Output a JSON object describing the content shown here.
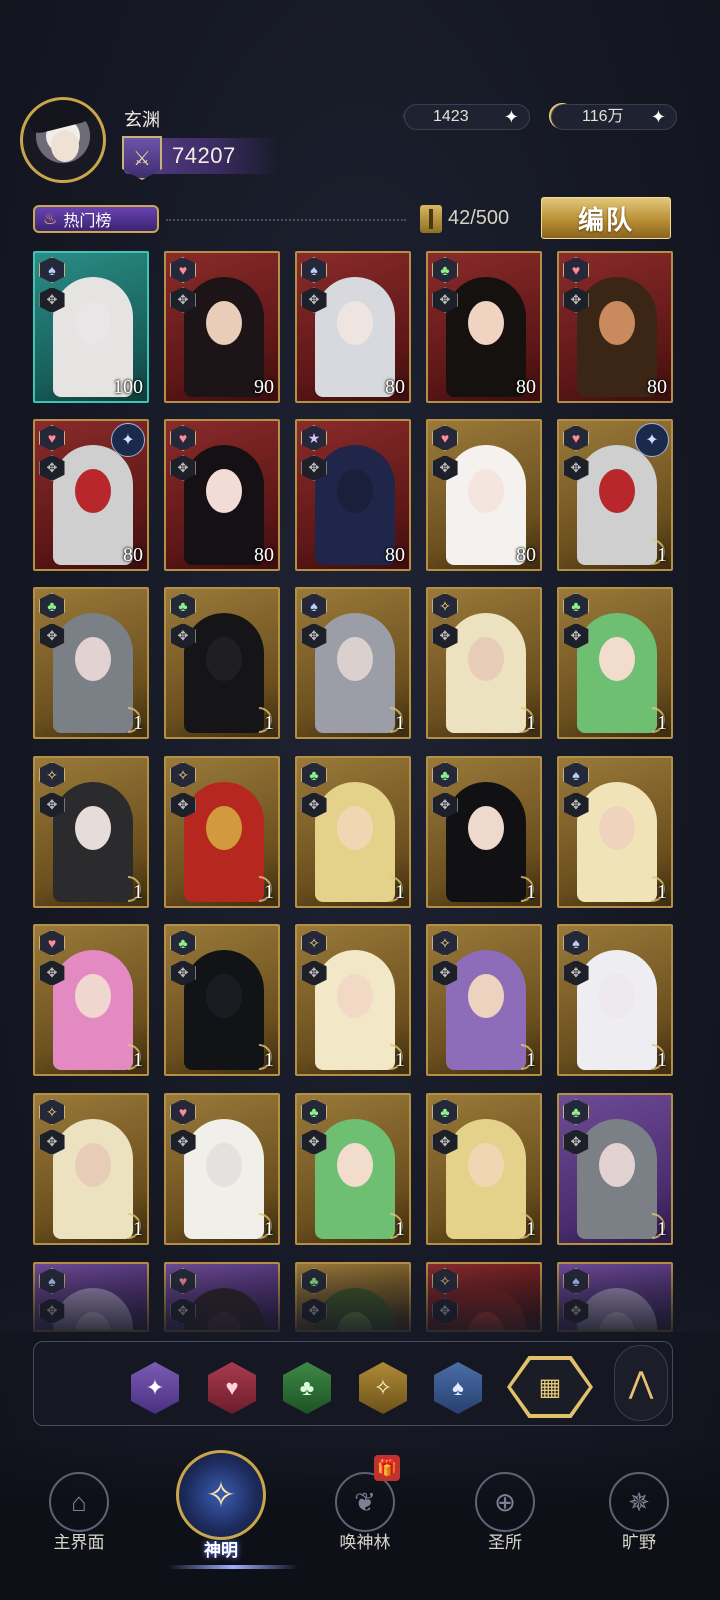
{
  "header": {
    "username": "玄渊",
    "power": "74207",
    "currencies": [
      {
        "name": "star-gem",
        "value": "1423"
      },
      {
        "name": "gold-coin",
        "value": "116万"
      }
    ]
  },
  "toolbar": {
    "hot_tab_label": "热门榜",
    "card_count": "42/500",
    "team_button": "编队"
  },
  "cards": [
    {
      "frame": "teal",
      "element": "spade",
      "level": "100",
      "face": "#e8e6e6",
      "hair": "#e6e4e2"
    },
    {
      "frame": "red",
      "element": "heart",
      "level": "90",
      "face": "#e9cdb9",
      "hair": "#1c1416"
    },
    {
      "frame": "red",
      "element": "spade",
      "level": "80",
      "face": "#eee5e1",
      "hair": "#d7d9de"
    },
    {
      "frame": "red",
      "element": "club",
      "level": "80",
      "face": "#f0d3c0",
      "hair": "#15110f"
    },
    {
      "frame": "red",
      "element": "heart",
      "level": "80",
      "face": "#c98b5d",
      "hair": "#3b2616"
    },
    {
      "frame": "red",
      "element": "heart",
      "level": "80",
      "face": "#b8272b",
      "hair": "#cfcfcf",
      "badge": "✦"
    },
    {
      "frame": "red",
      "element": "heart",
      "level": "80",
      "face": "#f3dcd6",
      "hair": "#141013"
    },
    {
      "frame": "red",
      "element": "star",
      "level": "80",
      "face": "#1a1f3a",
      "hair": "#20264a"
    },
    {
      "frame": "gold",
      "element": "heart",
      "level": "80",
      "face": "#f4e6df",
      "hair": "#f5f1ee"
    },
    {
      "frame": "gold",
      "element": "heart",
      "level": "1",
      "face": "#b8272b",
      "hair": "#cfcfcf",
      "badge": "✦"
    },
    {
      "frame": "gold",
      "element": "club",
      "level": "1",
      "face": "#e2d3d2",
      "hair": "#7b8087"
    },
    {
      "frame": "gold",
      "element": "club",
      "level": "1",
      "face": "#1f1f22",
      "hair": "#151518"
    },
    {
      "frame": "gold",
      "element": "spade",
      "level": "1",
      "face": "#dad0ce",
      "hair": "#9b9ea6"
    },
    {
      "frame": "gold",
      "element": "gold",
      "level": "1",
      "face": "#e7cdb8",
      "hair": "#ede2c0"
    },
    {
      "frame": "gold",
      "element": "club",
      "level": "1",
      "face": "#f2dccc",
      "hair": "#6fbf73"
    },
    {
      "frame": "gold",
      "element": "gold",
      "level": "1",
      "face": "#e6dcd9",
      "hair": "#2b2a2c"
    },
    {
      "frame": "gold",
      "element": "gold",
      "level": "1",
      "face": "#d39a3d",
      "hair": "#b5271f"
    },
    {
      "frame": "gold",
      "element": "club",
      "level": "1",
      "face": "#f1d6b4",
      "hair": "#e5d28a"
    },
    {
      "frame": "gold",
      "element": "club",
      "level": "1",
      "face": "#efd8cc",
      "hair": "#111013"
    },
    {
      "frame": "gold",
      "element": "spade",
      "level": "1",
      "face": "#f0d3bd",
      "hair": "#f1e3b8"
    },
    {
      "frame": "gold",
      "element": "heart",
      "level": "1",
      "face": "#efd6cf",
      "hair": "#e48ac2"
    },
    {
      "frame": "gold",
      "element": "club",
      "level": "1",
      "face": "#1a1c22",
      "hair": "#121317"
    },
    {
      "frame": "gold",
      "element": "gold",
      "level": "1",
      "face": "#f1d9c6",
      "hair": "#f2e8c8"
    },
    {
      "frame": "gold",
      "element": "gold",
      "level": "1",
      "face": "#edd2bf",
      "hair": "#8d6db9"
    },
    {
      "frame": "gold",
      "element": "spade",
      "level": "1",
      "face": "#ece8eb",
      "hair": "#eeeef2"
    },
    {
      "frame": "gold",
      "element": "gold",
      "level": "1",
      "face": "#e7cdb8",
      "hair": "#ede2c0"
    },
    {
      "frame": "gold",
      "element": "heart",
      "level": "1",
      "face": "#e4e2de",
      "hair": "#f1efea"
    },
    {
      "frame": "gold",
      "element": "club",
      "level": "1",
      "face": "#f2dccc",
      "hair": "#6fbf73"
    },
    {
      "frame": "gold",
      "element": "club",
      "level": "1",
      "face": "#f1d6b4",
      "hair": "#e5d28a"
    },
    {
      "frame": "purple",
      "element": "club",
      "level": "1",
      "face": "#e2d3d2",
      "hair": "#7b8087"
    },
    {
      "frame": "purple",
      "element": "spade",
      "level": "",
      "face": "#c9b7d8",
      "hair": "#9c8ab4"
    },
    {
      "frame": "purple",
      "element": "heart",
      "level": "",
      "face": "#4a2f3a",
      "hair": "#2d2026"
    },
    {
      "frame": "gold",
      "element": "club",
      "level": "",
      "face": "#6a8c3a",
      "hair": "#3d5422"
    },
    {
      "frame": "red",
      "element": "gold",
      "level": "",
      "face": "#b5342c",
      "hair": "#7a1d1a"
    },
    {
      "frame": "purple",
      "element": "spade",
      "level": "",
      "face": "#c9b7d8",
      "hair": "#9c8ab4"
    }
  ],
  "filters": [
    {
      "name": "star",
      "glyph": "✦"
    },
    {
      "name": "heart",
      "glyph": "♥"
    },
    {
      "name": "club",
      "glyph": "♣"
    },
    {
      "name": "gold",
      "glyph": "✧"
    },
    {
      "name": "spade",
      "glyph": "♠"
    },
    {
      "name": "all",
      "glyph": "▦"
    }
  ],
  "collapse_glyph": "⋀",
  "nav": [
    {
      "label": "主界面",
      "glyph": "⌂"
    },
    {
      "label": "神明",
      "glyph": "✧"
    },
    {
      "label": "唤神林",
      "glyph": "❦"
    },
    {
      "label": "圣所",
      "glyph": "⊕"
    },
    {
      "label": "旷野",
      "glyph": "✵"
    }
  ],
  "gift_glyph": "🎁"
}
